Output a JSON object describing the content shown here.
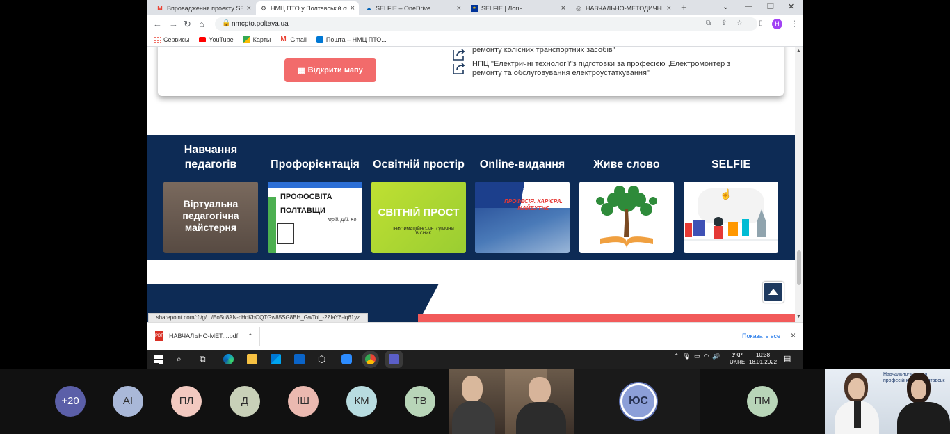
{
  "browser": {
    "tabs": [
      {
        "label": "Впровадження проекту SELFIE",
        "icon": "gmail-icon",
        "active": false
      },
      {
        "label": "НМЦ ПТО у Полтавській об",
        "icon": "site-gear-icon",
        "active": true
      },
      {
        "label": "SELFIE – OneDrive",
        "icon": "onedrive-icon",
        "active": false
      },
      {
        "label": "SELFIE | Логін",
        "icon": "eu-flag-icon",
        "active": false
      },
      {
        "label": "НАВЧАЛЬНО-МЕТОДИЧНИЙ",
        "icon": "globe-icon",
        "active": false
      }
    ],
    "new_tab": "+",
    "url": "nmcpto.poltava.ua",
    "profile_initial": "H",
    "bookmarks": [
      {
        "label": "Сервисы",
        "icon": "apps-grid-icon"
      },
      {
        "label": "YouTube",
        "icon": "youtube-icon"
      },
      {
        "label": "Карты",
        "icon": "maps-icon"
      },
      {
        "label": "Gmail",
        "icon": "gmail-icon"
      },
      {
        "label": "Пошта – НМЦ ПТО...",
        "icon": "outlook-icon"
      }
    ]
  },
  "page": {
    "map_button": "Відкрити мапу",
    "courses": [
      {
        "text_line1": "",
        "text_line2": "ремонту колісних транспортних засобів\""
      },
      {
        "text_line1": "НПЦ \"Електричні технології\"з підготовки за професією „Електромонтер з",
        "text_line2": "ремонту та обслуговування електроустаткування\""
      }
    ],
    "sections": [
      {
        "title": "Навчання педагогів",
        "thumb_text": "Віртуальна педагогічна майстерня"
      },
      {
        "title": "Профорієнтація",
        "thumb_text": "ПРОФОСВІТА ПОЛТАВЩИ",
        "thumb_sub": "Мрій. Дій. Ко"
      },
      {
        "title": "Освітній простір",
        "thumb_text": "СВІТНІЙ ПРОСТ",
        "thumb_sub": "ІНФОРМАЦІЙНО-МЕТОДИЧНИ ВІСНИК"
      },
      {
        "title": "Online-видання",
        "thumb_text": "ПРОФЕСІЯ. КАР'ЄРА. МАЙБУТНЄ"
      },
      {
        "title": "Живе слово",
        "thumb_text": ""
      },
      {
        "title": "SELFIE",
        "thumb_text": ""
      }
    ],
    "status_url": "...sharepoint.com/:f:/g/.../Eo5u8AN-cHdKhOQTGw85SG8BH_GwTol_-2ZlaY6-iq61yz..."
  },
  "downloads": {
    "file": "НАВЧАЛЬНО-МЕТ....pdf",
    "show_all": "Показать все",
    "close": "×"
  },
  "taskbar": {
    "lang_top": "УКР",
    "lang_bottom": "UKRE",
    "time": "10:38",
    "date": "18.01.2022"
  },
  "meeting": {
    "participants": [
      {
        "initials": "+20",
        "color": "#5b5fa8",
        "text_color": "#ffffff"
      },
      {
        "initials": "AI",
        "color": "#a9b8d8"
      },
      {
        "initials": "ПЛ",
        "color": "#f2c9c0"
      },
      {
        "initials": "Д",
        "color": "#c8d0b8"
      },
      {
        "initials": "ІШ",
        "color": "#ebb9b0"
      },
      {
        "initials": "КМ",
        "color": "#b8dce0"
      },
      {
        "initials": "ТВ",
        "color": "#b8d5b8"
      }
    ],
    "active_speaker": "ЮС",
    "last_participant": "ПМ",
    "video2_text": "Навчально-м центр професійно-те у Полтавськ"
  }
}
